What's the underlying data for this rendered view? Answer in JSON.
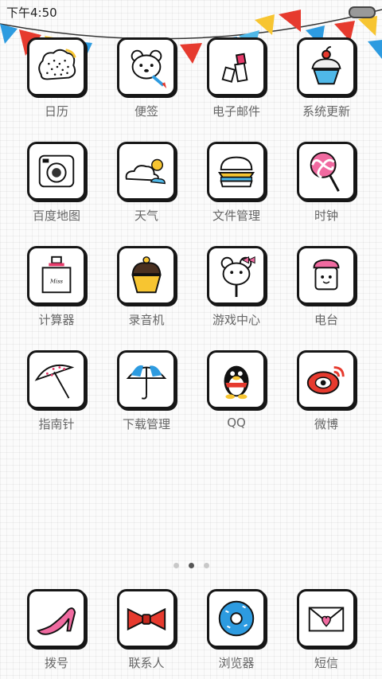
{
  "status_bar": {
    "time": "下午4:50"
  },
  "apps": [
    {
      "label": "日历",
      "icon": "calendar-icon"
    },
    {
      "label": "便签",
      "icon": "bear-note-icon"
    },
    {
      "label": "电子邮件",
      "icon": "lipstick-icon"
    },
    {
      "label": "系统更新",
      "icon": "cupcake-icon"
    },
    {
      "label": "百度地图",
      "icon": "camera-icon"
    },
    {
      "label": "天气",
      "icon": "cloud-sun-icon"
    },
    {
      "label": "文件管理",
      "icon": "burger-icon"
    },
    {
      "label": "时钟",
      "icon": "lollipop-icon"
    },
    {
      "label": "计算器",
      "icon": "perfume-icon"
    },
    {
      "label": "录音机",
      "icon": "muffin-icon"
    },
    {
      "label": "游戏中心",
      "icon": "bear-candy-icon"
    },
    {
      "label": "电台",
      "icon": "jar-icon"
    },
    {
      "label": "指南针",
      "icon": "polka-umbrella-icon"
    },
    {
      "label": "下载管理",
      "icon": "blue-umbrella-icon"
    },
    {
      "label": "QQ",
      "icon": "penguin-icon"
    },
    {
      "label": "微博",
      "icon": "weibo-eye-icon"
    }
  ],
  "page_indicator": {
    "count": 3,
    "active": 2
  },
  "dock": [
    {
      "label": "拨号",
      "icon": "high-heel-icon"
    },
    {
      "label": "联系人",
      "icon": "bow-tie-icon"
    },
    {
      "label": "浏览器",
      "icon": "donut-icon"
    },
    {
      "label": "短信",
      "icon": "envelope-heart-icon"
    }
  ],
  "colors": {
    "label": "#666666",
    "frame": "#161616",
    "bunting": [
      "#e63a2e",
      "#f7c531",
      "#2d9be0",
      "#4fb8e8"
    ]
  }
}
